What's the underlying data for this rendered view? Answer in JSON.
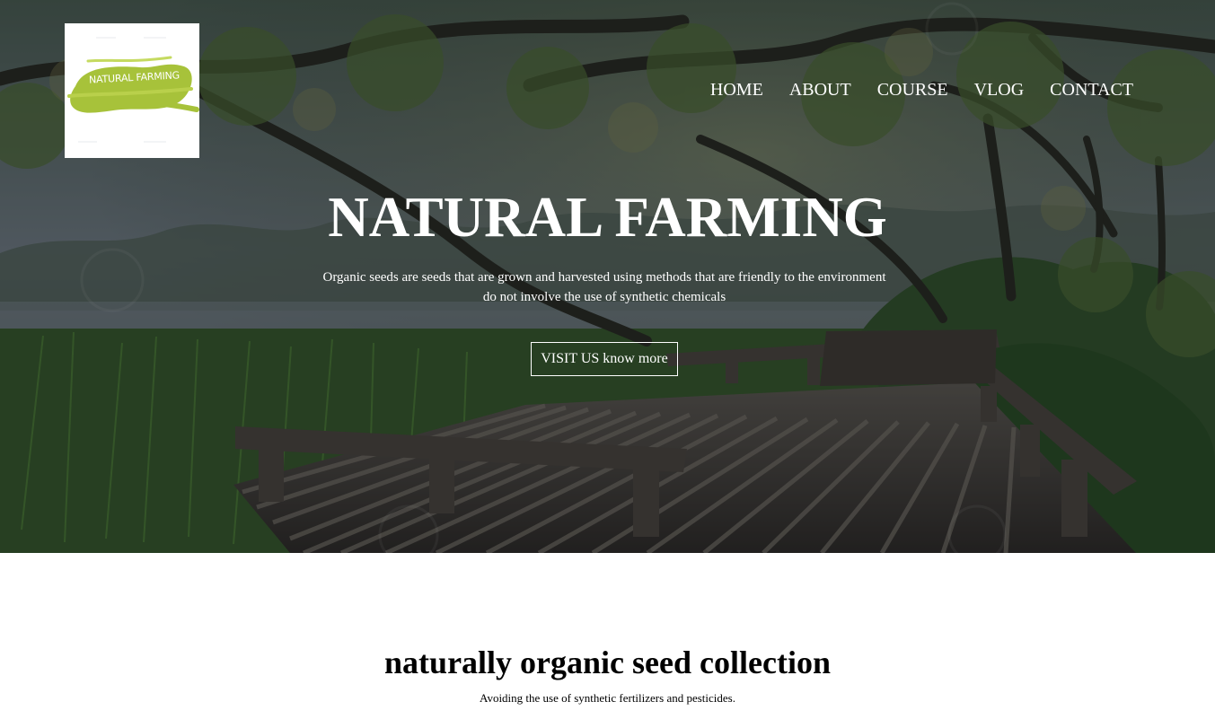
{
  "brand": {
    "logo_text": "NATURAL FARMING",
    "accent_color": "#a7c23a"
  },
  "nav": {
    "items": [
      "HOME",
      "ABOUT",
      "COURSE",
      "VLOG",
      "CONTACT"
    ]
  },
  "hero": {
    "title": "NATURAL FARMING",
    "subtitle_line1": "Organic seeds are seeds that are grown and harvested using methods that are friendly to the environment",
    "subtitle_line2": "do not involve the use of synthetic chemicals",
    "cta_label": "VISIT US know more"
  },
  "collection": {
    "title": "naturally organic seed collection",
    "subtitle": "Avoiding the use of synthetic fertilizers and pesticides."
  }
}
